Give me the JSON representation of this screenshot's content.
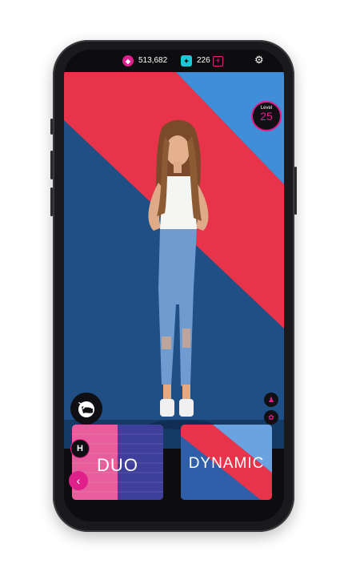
{
  "topbar": {
    "gems_icon": "gem-icon",
    "gems_value": "513,682",
    "tickets_icon": "ticket-icon",
    "tickets_value": "226",
    "plus_label": "+",
    "settings_icon": "gear-icon"
  },
  "level": {
    "label": "Level",
    "value": "25"
  },
  "cards": [
    {
      "label": "DUO"
    },
    {
      "label": "DYNAMIC"
    }
  ],
  "colors": {
    "accent_pink": "#e0208a",
    "accent_cyan": "#1ec7d8",
    "bg_red": "#e8344a",
    "bg_blue": "#1f4f84",
    "bg_light_blue": "#3f8fd8"
  }
}
